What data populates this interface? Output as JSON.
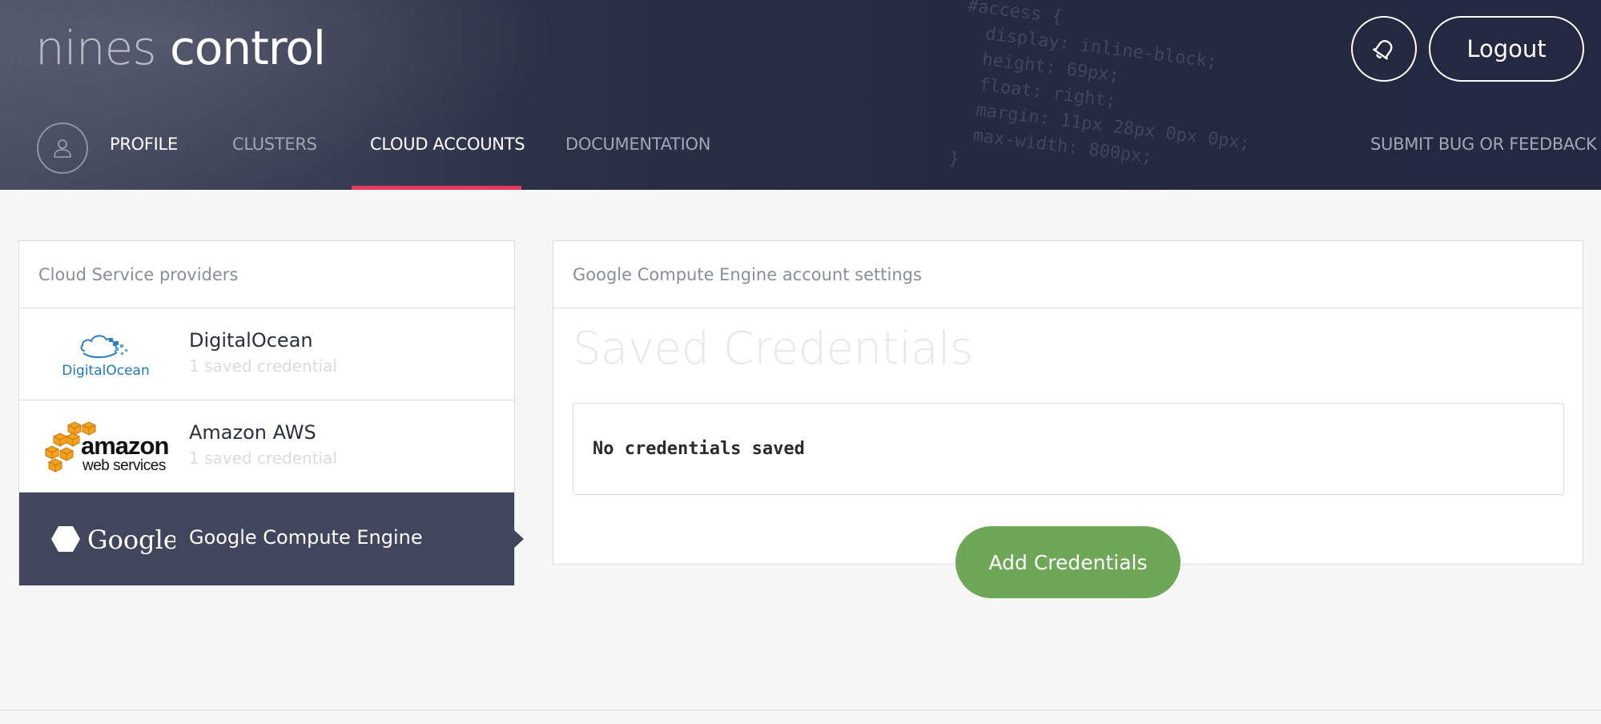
{
  "app": {
    "logo_light": "nines",
    "logo_bold": "control"
  },
  "header": {
    "logout_label": "Logout",
    "bell_icon": "bell-icon",
    "avatar_icon": "user-icon"
  },
  "nav": {
    "items": [
      {
        "label": "PROFILE"
      },
      {
        "label": "CLUSTERS"
      },
      {
        "label": "CLOUD ACCOUNTS",
        "active": true
      },
      {
        "label": "DOCUMENTATION"
      }
    ],
    "feedback_label": "SUBMIT BUG OR FEEDBACK",
    "active_color": "#e83a63"
  },
  "providers": {
    "title": "Cloud Service providers",
    "items": [
      {
        "name": "DigitalOcean",
        "subtitle": "1 saved credential",
        "logo_text": "DigitalOcean"
      },
      {
        "name": "Amazon AWS",
        "subtitle": "1 saved credential",
        "logo_text_1": "amazon",
        "logo_text_2": "web services"
      },
      {
        "name": "Google Compute Engine",
        "logo_text": "Google",
        "active": true
      }
    ]
  },
  "settings": {
    "title": "Google Compute Engine account settings",
    "saved_title": "Saved Credentials",
    "empty_message": "No credentials saved",
    "add_button_label": "Add Credentials",
    "add_button_color": "#6ea758"
  },
  "code_lines": [
    "#access {",
    "  display: inline-block;",
    "  height: 69px;",
    "  float: right;",
    "  margin: 11px 28px 0px 0px;",
    "  max-width: 800px;",
    "}"
  ]
}
